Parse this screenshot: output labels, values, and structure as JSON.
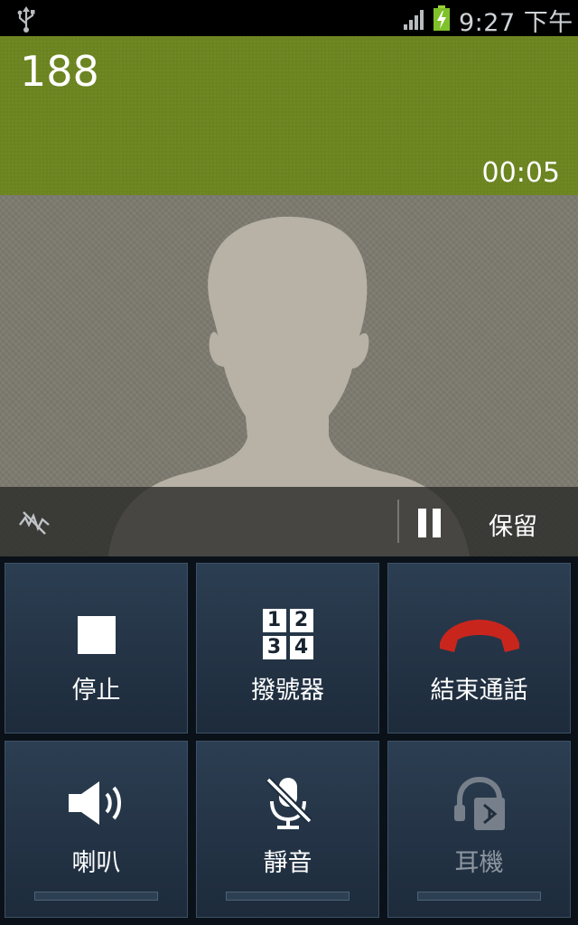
{
  "status_bar": {
    "usb_icon": "usb-icon",
    "signal_icon": "signal-strength-icon",
    "battery_icon": "battery-charging-icon",
    "time": "9:27 下午"
  },
  "call": {
    "number": "188",
    "duration": "00:05"
  },
  "hold_bar": {
    "hd_icon": "hd-voice-off-icon",
    "pause_icon": "pause-icon",
    "label": "保留"
  },
  "buttons": [
    {
      "label": "停止",
      "icon": "stop-icon"
    },
    {
      "label": "撥號器",
      "icon": "dialpad-icon",
      "keys": [
        "1",
        "2",
        "3",
        "4"
      ]
    },
    {
      "label": "結束通話",
      "icon": "end-call-icon"
    },
    {
      "label": "喇叭",
      "icon": "speaker-icon"
    },
    {
      "label": "靜音",
      "icon": "mute-mic-icon"
    },
    {
      "label": "耳機",
      "icon": "bluetooth-headset-icon"
    }
  ],
  "colors": {
    "caller_bg": "#6b8420",
    "end_call": "#c8261d",
    "button_bg": "#24364a"
  }
}
